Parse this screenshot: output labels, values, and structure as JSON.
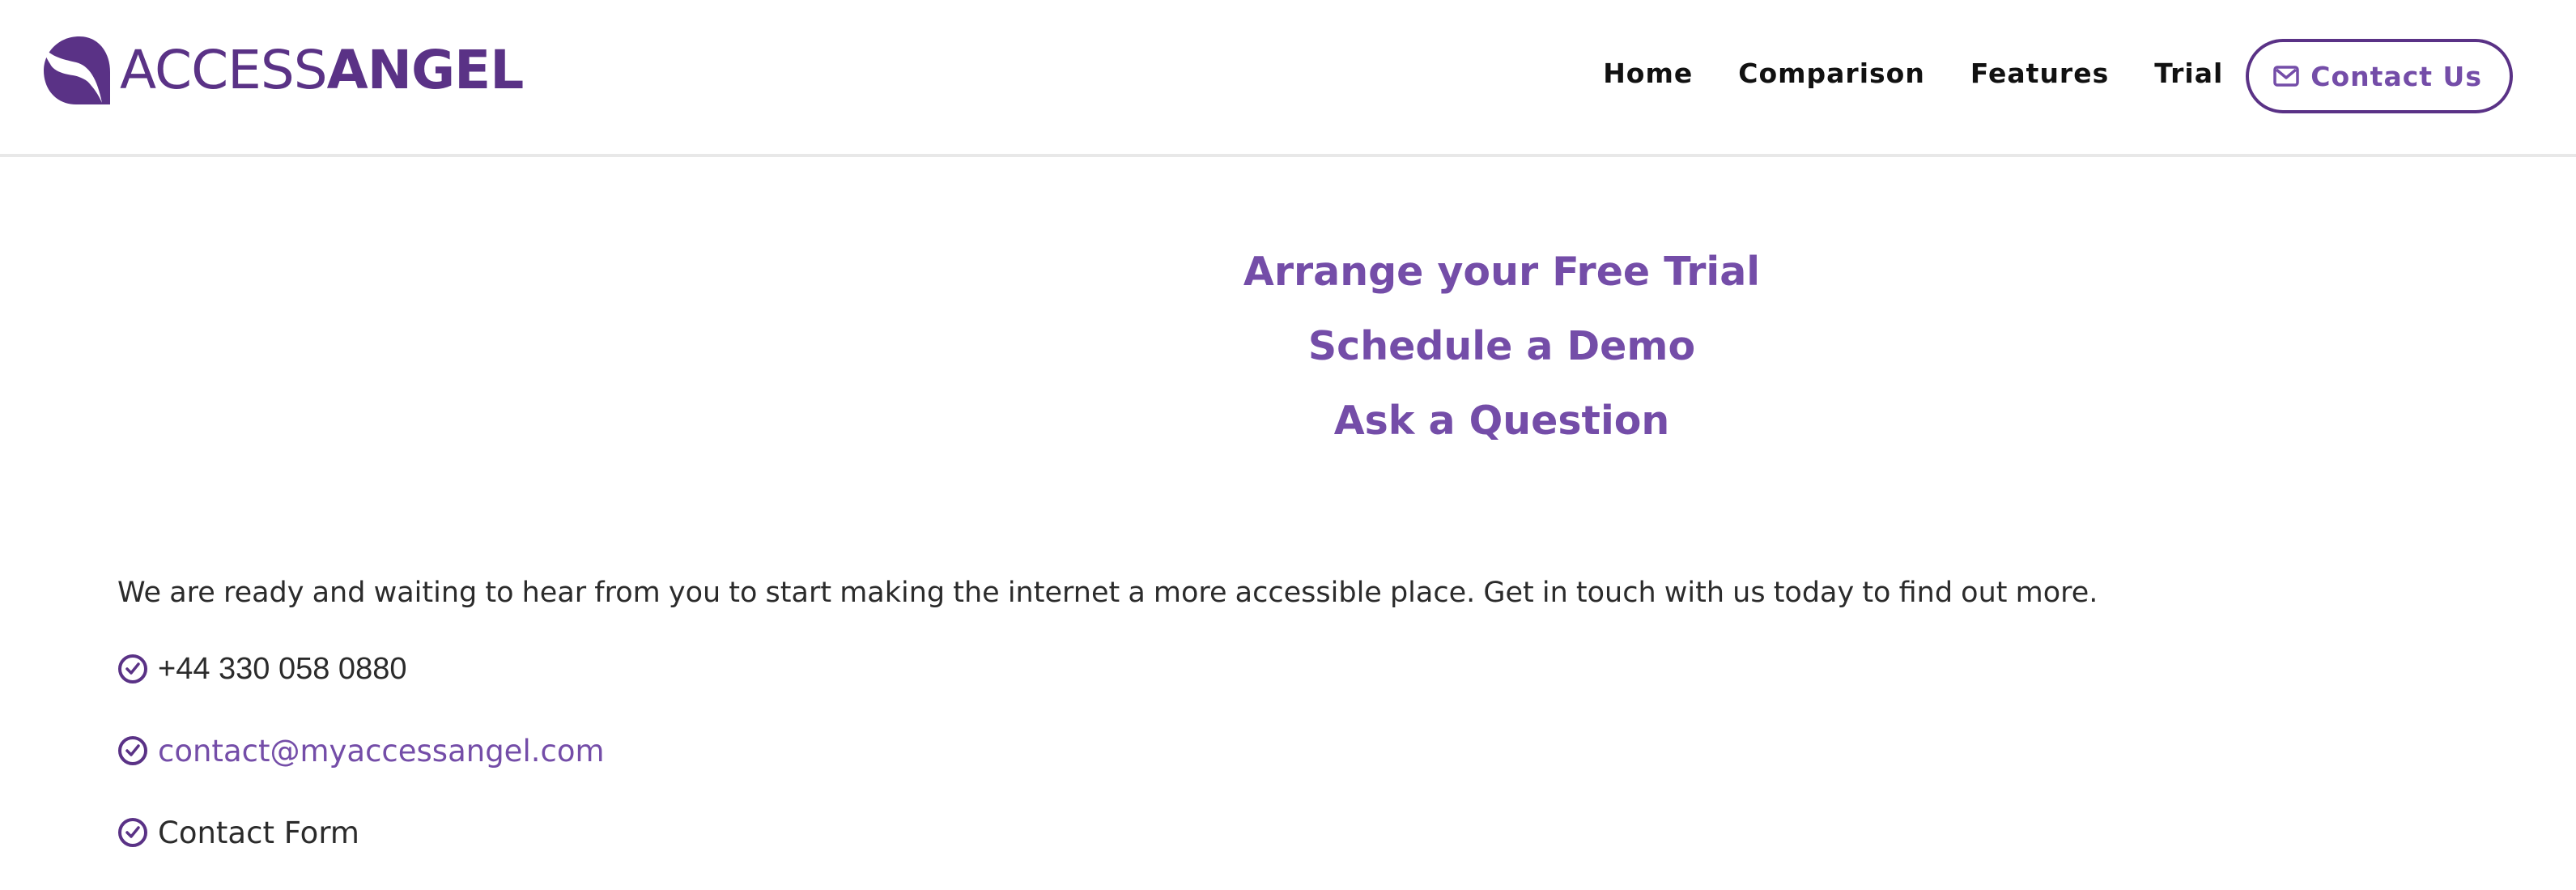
{
  "brand": {
    "name_light": "ACCESS",
    "name_bold": "ANGEL",
    "logo_icon": "angel-wing-icon",
    "color_primary": "#5a3286",
    "color_accent": "#744da8"
  },
  "nav": {
    "items": [
      {
        "label": "Home"
      },
      {
        "label": "Comparison"
      },
      {
        "label": "Features"
      },
      {
        "label": "Trial"
      }
    ],
    "contact_button": {
      "label": "Contact Us",
      "icon": "envelope-icon"
    }
  },
  "main": {
    "ctas": [
      {
        "label": "Arrange your Free Trial"
      },
      {
        "label": "Schedule a Demo"
      },
      {
        "label": "Ask a Question"
      }
    ],
    "intro": "We are ready and waiting to hear from you to start making the internet a more accessible place. Get in touch with us today to find out more.",
    "contacts": [
      {
        "icon": "check-circle-icon",
        "label": "+44 330 058 0880",
        "type": "phone"
      },
      {
        "icon": "check-circle-icon",
        "label": "contact@myaccessangel.com",
        "type": "email"
      },
      {
        "icon": "check-circle-icon",
        "label": "Contact Form",
        "type": "form"
      }
    ]
  }
}
